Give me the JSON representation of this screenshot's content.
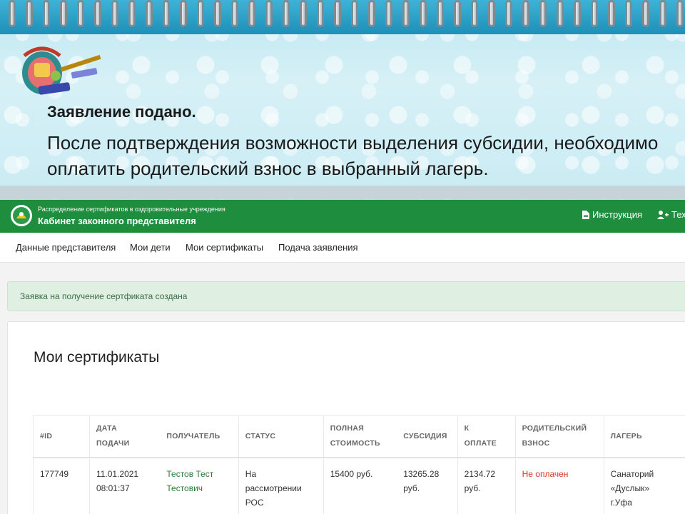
{
  "slide": {
    "heading": "Заявление подано.",
    "body": "После подтверждения возможности выделения субсидии, необходимо оплатить родительский взнос в выбранный лагерь."
  },
  "portal": {
    "subtitle": "Распределение сертификатов в оздоровительные учреждения",
    "title": "Кабинет законного представителя",
    "links": [
      {
        "label": "Инструкция",
        "icon": "document-icon"
      },
      {
        "label": "Тех",
        "icon": "user-plus-icon"
      }
    ],
    "colors": {
      "header": "#1e8e3e"
    }
  },
  "nav": {
    "items": [
      "Данные представителя",
      "Мои дети",
      "Мои сертификаты",
      "Подача заявления"
    ]
  },
  "alert": {
    "text": "Заявка на получение сертфиката создана"
  },
  "certificates": {
    "title": "Мои сертификаты",
    "columns": [
      {
        "line1": "#ID",
        "line2": ""
      },
      {
        "line1": "ДАТА",
        "line2": "ПОДАЧИ"
      },
      {
        "line1": "ПОЛУЧАТЕЛЬ",
        "line2": ""
      },
      {
        "line1": "СТАТУС",
        "line2": ""
      },
      {
        "line1": "ПОЛНАЯ",
        "line2": "СТОИМОСТЬ"
      },
      {
        "line1": "СУБСИДИЯ",
        "line2": ""
      },
      {
        "line1": "К",
        "line2": "ОПЛАТЕ"
      },
      {
        "line1": "РОДИТЕЛЬСКИЙ",
        "line2": "ВЗНОС"
      },
      {
        "line1": "ЛАГЕРЬ",
        "line2": ""
      }
    ],
    "rows": [
      {
        "id": "177749",
        "date": "11.01.2021",
        "time": "08:01:37",
        "recipient_1": "Тестов Тест",
        "recipient_2": "Тестович",
        "status_1": "На",
        "status_2": "рассмотрении",
        "status_3": "РОС",
        "full_cost": "15400 руб.",
        "subsidy_1": "13265.28",
        "subsidy_2": "руб.",
        "to_pay_1": "2134.72",
        "to_pay_2": "руб.",
        "parent_fee": "Не оплачен",
        "camp_1": "Санаторий",
        "camp_2": "«Дуслык»",
        "camp_3": "г.Уфа"
      }
    ]
  }
}
